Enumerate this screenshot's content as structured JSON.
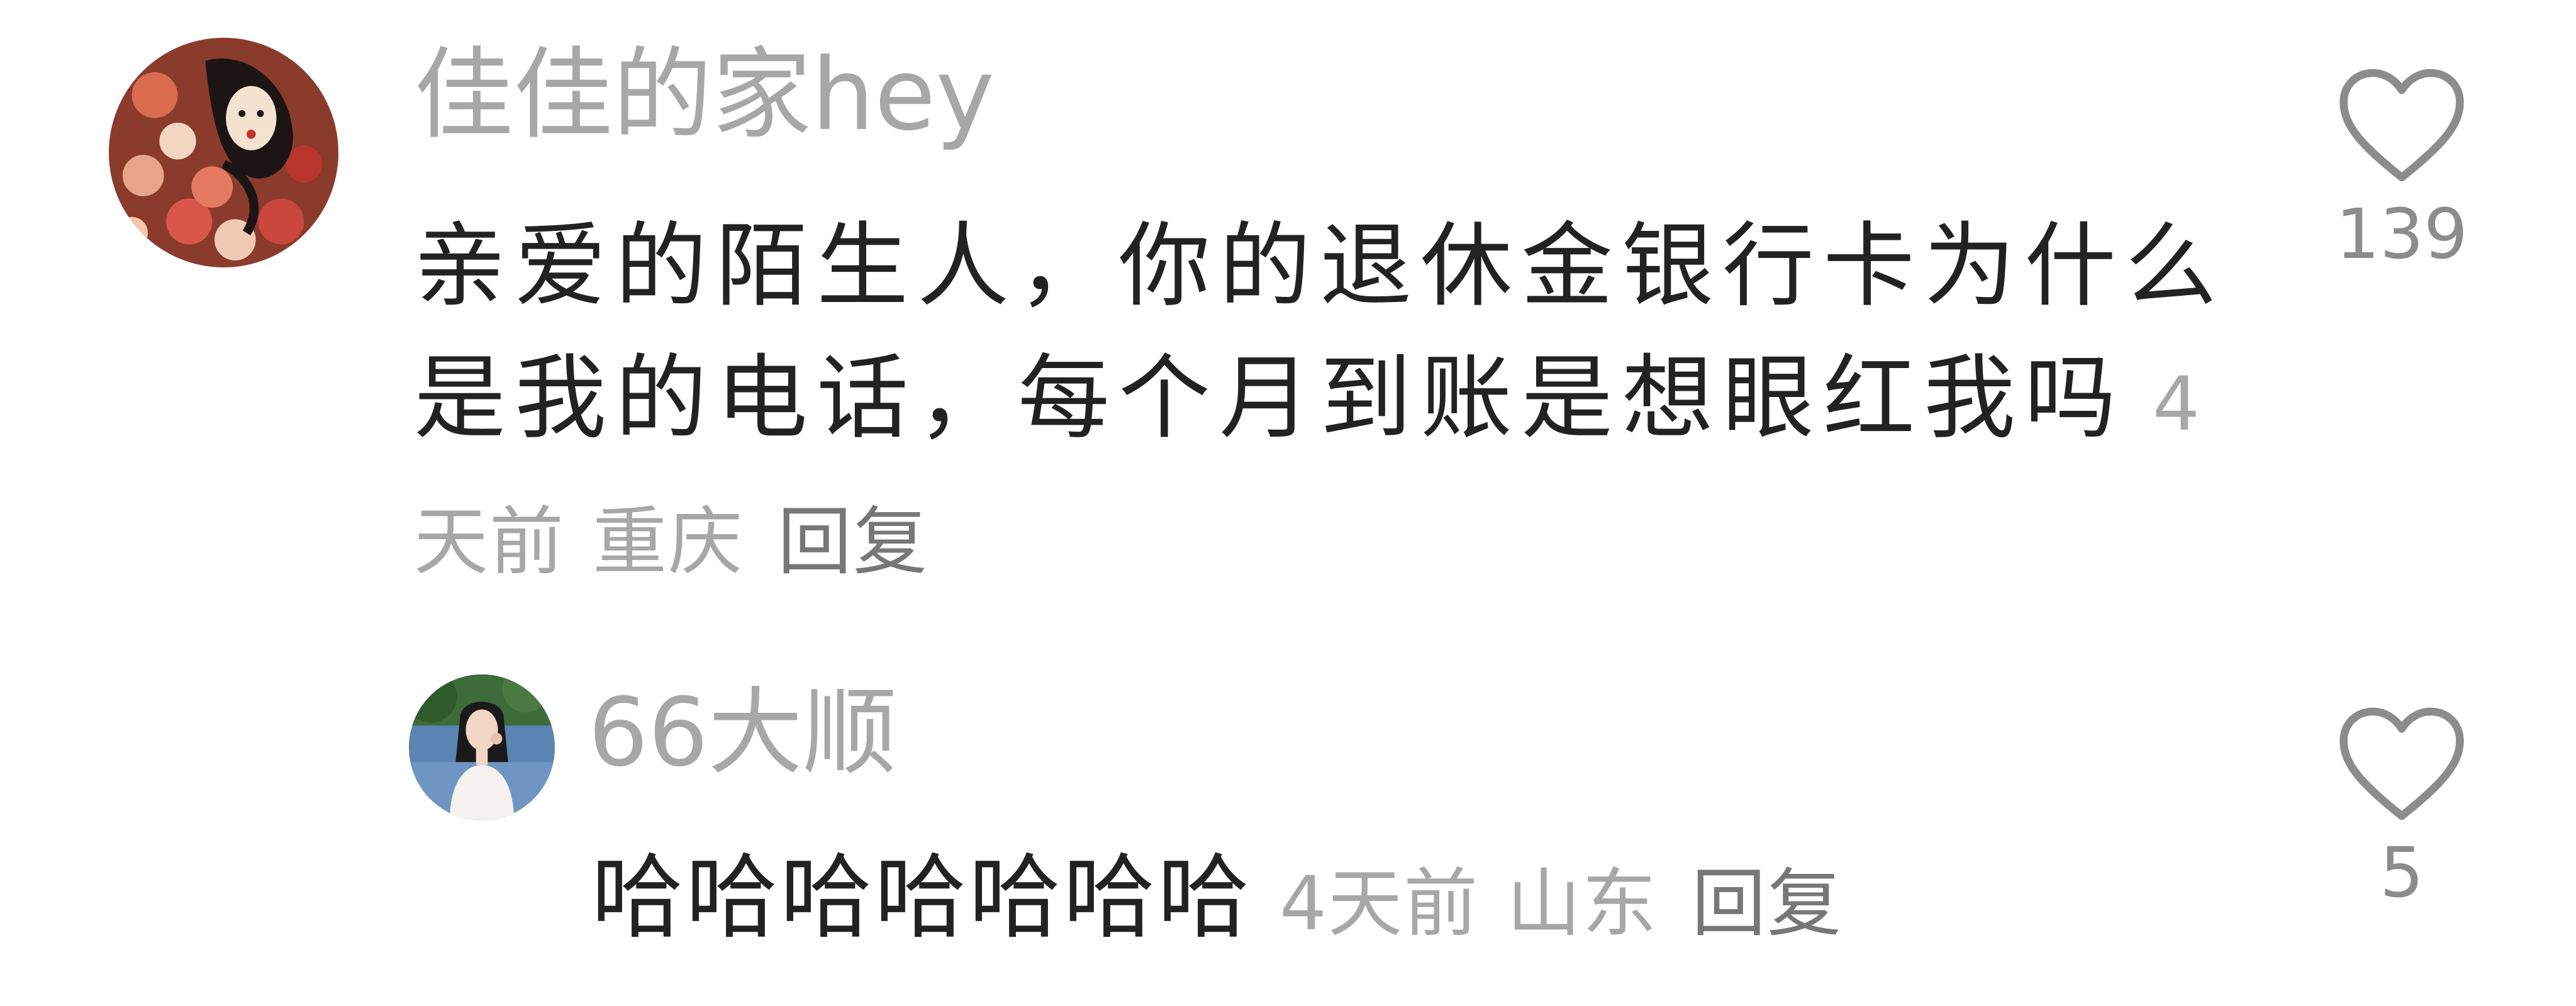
{
  "comments": [
    {
      "username": "佳佳的家hey",
      "text": "亲爱的陌生人，你的退休金银行卡为什么是我的电话，每个月到账是想眼红我吗",
      "time": "4天前",
      "location": "重庆",
      "reply_label": "回复",
      "like_count": "139",
      "avatar_icon": "illustrated-woman-avatar",
      "like_icon": "heart-outline-icon"
    },
    {
      "username": "66大顺",
      "text": "哈哈哈哈哈哈哈",
      "time": "4天前",
      "location": "山东",
      "reply_label": "回复",
      "like_count": "5",
      "avatar_icon": "photo-woman-avatar",
      "like_icon": "heart-outline-icon"
    }
  ],
  "colors": {
    "background": "#ffffff",
    "username": "#a7a7a7",
    "body_text": "#222222",
    "meta_text": "#a7a7a7",
    "heart_stroke": "#8c8c8c"
  }
}
